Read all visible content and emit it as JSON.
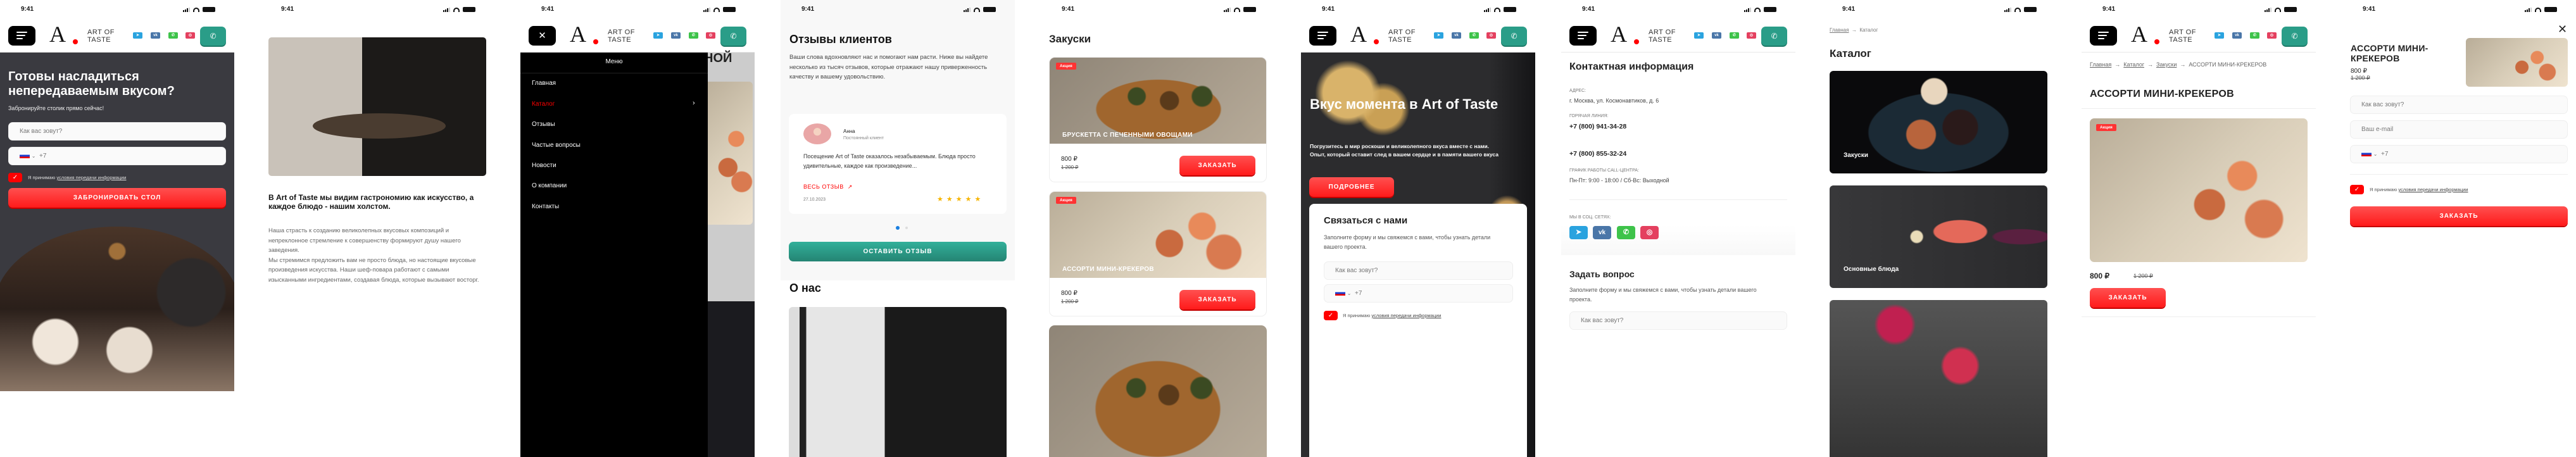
{
  "status": {
    "time": "9:41"
  },
  "header": {
    "logo_mark": "A",
    "logo_line1": "ART OF",
    "logo_line2": "TASTE",
    "socials": [
      "telegram-icon",
      "vk-icon",
      "whatsapp-icon",
      "instagram-icon"
    ],
    "call_icon": "phone-icon"
  },
  "colors": {
    "brand_red": "#ff2020",
    "brand_teal": "#2a9d88",
    "dark": "#3a3a40"
  },
  "booking": {
    "title": "Готовы насладиться непередаваемым вкусом?",
    "subtitle": "Забронируйте столик прямо сейчас!",
    "name_placeholder": "Как вас зовут?",
    "phone_prefix": "+7",
    "agree_text": "Я принимаю",
    "agree_link": "условия передачи информации",
    "submit": "ЗАБРОНИРОВАТЬ СТОЛ"
  },
  "about": {
    "heading": "В Art of Taste мы видим гастрономию как искусство, а каждое блюдо - нашим холстом.",
    "paragraph1": "Наша страсть к созданию великолепных вкусовых композиций и непреклонное стремление к совершенству формируют душу нашего заведения.",
    "paragraph2": "Мы стремимся предложить вам не просто блюда, но настоящие вкусовые произведения искусства. Наши шеф-повара работают с самыми изысканными ингредиентами, создавая блюда, которые вызывают восторг."
  },
  "menu": {
    "title": "Меню",
    "items": [
      "Главная",
      "Каталог",
      "Отзывы",
      "Частые вопросы",
      "Новости",
      "О компании",
      "Контакты"
    ],
    "backdrop_heading": "НОЙ"
  },
  "reviews": {
    "title": "Отзывы клиентов",
    "intro": "Ваши слова вдохновляют нас и помогают нам расти. Ниже вы найдете несколько из тысяч отзывов, которые отражают нашу приверженность качеству и вашему удовольствию.",
    "card": {
      "name": "Анна",
      "role": "Постоянный клиент",
      "text": "Посещение Art of Taste оказалось незабываемым. Блюда просто удивительные, каждое как произведение...",
      "more": "ВЕСЬ ОТЗЫВ",
      "date": "27.10.2023",
      "rating": 5
    },
    "slides": 2,
    "active_slide": 1,
    "leave_review": "ОСТАВИТЬ ОТЗЫВ",
    "about_title": "О нас"
  },
  "snacks": {
    "title": "Закуски",
    "products": [
      {
        "badge": "Акция",
        "name": "БРУСКЕТТА С ПЕЧЕННЫМИ ОВОЩАМИ",
        "price": "800 ₽",
        "old_price": "1 200 ₽",
        "order": "ЗАКАЗАТЬ"
      },
      {
        "badge": "Акция",
        "name": "АССОРТИ МИНИ-КРЕКЕРОВ",
        "price": "800 ₽",
        "old_price": "1 200 ₽",
        "order": "ЗАКАЗАТЬ"
      }
    ]
  },
  "hero": {
    "title": "Вкус момента в Art of Taste",
    "text": "Погрузитесь в мир роскоши и великолепного вкуса вместе с нами. Опыт, который оставит след в вашем сердце и в памяти вашего вкуса",
    "more": "ПОДРОБНЕЕ",
    "form_title": "Связаться с нами",
    "form_text": "Заполните форму и мы свяжемся с вами, чтобы узнать детали вашего проекта.",
    "name_placeholder": "Как вас зовут?",
    "phone_prefix": "+7",
    "agree_text": "Я принимаю",
    "agree_link": "условия передачи информации"
  },
  "contacts": {
    "title": "Контактная информация",
    "address_label": "АДРЕС:",
    "address": "г. Москва, ул. Космонавтиков, д. 6",
    "hotline_label": "ГОРЯЧАЯ ЛИНИЯ:",
    "phone1": "+7 (800) 941-34-28",
    "phone2": "+7 (800) 855-32-24",
    "hours_label": "ГРАФИК РАБОТЫ CALL-ЦЕНТРА:",
    "hours": "Пн-Пт: 9:00 - 18:00 / Сб-Вс: Выходной",
    "social_label": "МЫ В СОЦ. СЕТЯХ:",
    "ask_title": "Задать вопрос",
    "ask_text": "Заполните форму и мы свяжемся с вами, чтобы узнать детали вашего проекта.",
    "name_placeholder": "Как вас зовут?"
  },
  "catalog": {
    "breadcrumb": [
      "Главная",
      "Каталог"
    ],
    "title": "Каталог",
    "categories": [
      "Закуски",
      "Основные блюда"
    ]
  },
  "product": {
    "breadcrumb": [
      "Главная",
      "Каталог",
      "Закуски",
      "АССОРТИ МИНИ-КРЕКЕРОВ"
    ],
    "title": "АССОРТИ МИНИ-КРЕКЕРОВ",
    "badge": "Акция",
    "price": "800 ₽",
    "old_price": "1 200 ₽",
    "order": "ЗАКАЗАТЬ"
  },
  "order": {
    "title": "АССОРТИ МИНИ-КРЕКЕРОВ",
    "price": "800 ₽",
    "old_price": "1 200 ₽",
    "name_placeholder": "Как вас зовут?",
    "email_placeholder": "Ваш e-mail",
    "phone_prefix": "+7",
    "agree_text": "Я принимаю",
    "agree_link": "условия передачи информации",
    "submit": "ЗАКАЗАТЬ"
  }
}
